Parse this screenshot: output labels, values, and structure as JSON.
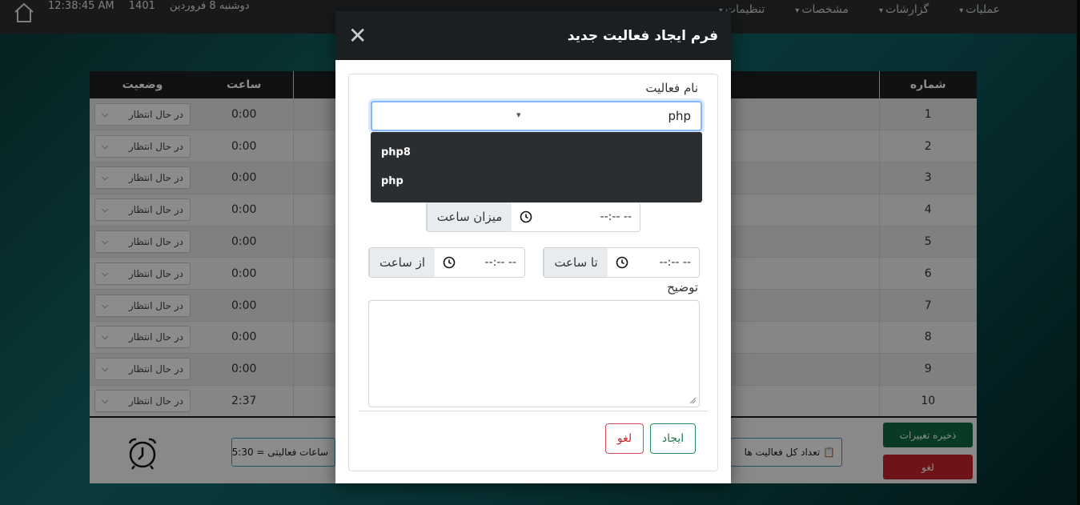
{
  "topbar": {
    "time": "12:38:45 AM",
    "year": "1401",
    "date": "دوشنبه 8 فروردین",
    "nav": [
      "عملیات",
      "گزارشات",
      "مشخصات",
      "تنظیمات"
    ]
  },
  "table": {
    "headers": {
      "number": "شماره",
      "hour": "ساعت",
      "status": "وضعیت"
    },
    "rows": [
      {
        "num": "1",
        "hour": "0:00",
        "status": "در حال انتظار"
      },
      {
        "num": "2",
        "hour": "0:00",
        "status": "در حال انتظار"
      },
      {
        "num": "3",
        "hour": "0:00",
        "status": "در حال انتظار"
      },
      {
        "num": "4",
        "hour": "0:00",
        "status": "در حال انتظار"
      },
      {
        "num": "5",
        "hour": "0:00",
        "status": "در حال انتظار"
      },
      {
        "num": "6",
        "hour": "0:00",
        "status": "در حال انتظار"
      },
      {
        "num": "7",
        "hour": "0:00",
        "status": "در حال انتظار"
      },
      {
        "num": "8",
        "hour": "0:00",
        "status": "در حال انتظار"
      },
      {
        "num": "9",
        "hour": "0:00",
        "status": "در حال انتظار"
      },
      {
        "num": "10",
        "hour": "2:37",
        "status": "در حال انتظار"
      }
    ]
  },
  "footer": {
    "save_label": "ذخیره تغییرات",
    "cancel_label": "لغو",
    "total_text": "تعداد کل فعالیت ها",
    "hours_text": "ساعات فعالیتی = 5:30"
  },
  "modal": {
    "title": "فرم ایجاد فعالیت جدید",
    "activity_label": "نام فعالیت",
    "activity_value": "php",
    "options": [
      "php8",
      "php"
    ],
    "duration_label": "میزان ساعت",
    "time_placeholder": "--:-- --",
    "to_label": "تا ساعت",
    "from_label": "از ساعت",
    "desc_label": "توضیح",
    "create_label": "ایجاد",
    "cancel_label": "لغو"
  }
}
